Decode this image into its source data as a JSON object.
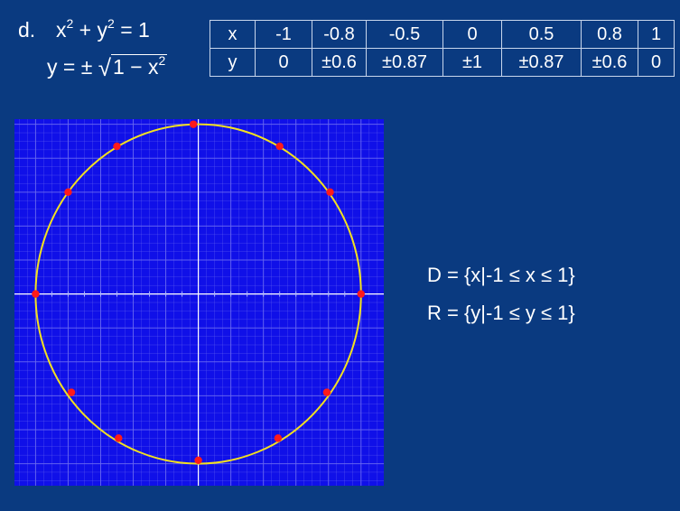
{
  "problem": {
    "label": "d.",
    "equation_line1": {
      "lhs_x": "x",
      "exp": "2",
      "plus": " + ",
      "lhs_y": "y",
      "exp2": "2",
      "rhs": " = 1"
    },
    "equation_line2": {
      "prefix": "y = ± ",
      "radicand": "1 − x",
      "exp": "2"
    }
  },
  "table": {
    "row_x": [
      "x",
      "-1",
      "-0.8",
      "-0.5",
      "0",
      "0.5",
      "0.8",
      "1"
    ],
    "row_y": [
      "y",
      "0",
      "±0.6",
      "±0.87",
      "±1",
      "±0.87",
      "±0.6",
      "0"
    ]
  },
  "domain": "D = {x|-1 ≤ x ≤ 1}",
  "range": "R = {y|-1 ≤ y ≤ 1}",
  "graph": {
    "background_color": "#1010e8",
    "grid_color": "#6a6af0",
    "axis_color": "#ffffff",
    "curve_color": "#f2e020",
    "point_color": "#ff1a1a",
    "xlim": [
      -1.13,
      1.14
    ],
    "ylim": [
      -1.13,
      1.03
    ],
    "curve": {
      "type": "circle",
      "center": [
        0,
        0
      ],
      "radius": 1
    },
    "points": [
      {
        "x": -1,
        "y": 0
      },
      {
        "x": -0.8,
        "y": 0.6
      },
      {
        "x": -0.5,
        "y": 0.87
      },
      {
        "x": -0.03,
        "y": 1
      },
      {
        "x": 0.5,
        "y": 0.87
      },
      {
        "x": 0.81,
        "y": 0.6
      },
      {
        "x": 1,
        "y": 0
      },
      {
        "x": 0.79,
        "y": -0.58
      },
      {
        "x": 0.49,
        "y": -0.85
      },
      {
        "x": 0,
        "y": -0.98
      },
      {
        "x": -0.49,
        "y": -0.85
      },
      {
        "x": -0.78,
        "y": -0.58
      }
    ]
  }
}
